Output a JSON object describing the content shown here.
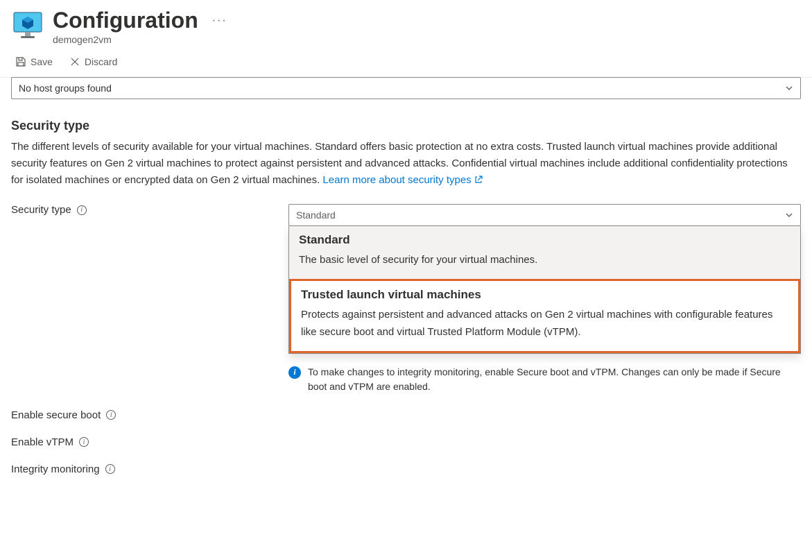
{
  "header": {
    "title": "Configuration",
    "subtitle": "demogen2vm"
  },
  "toolbar": {
    "save_label": "Save",
    "discard_label": "Discard"
  },
  "host_group": {
    "selected": "No host groups found"
  },
  "security": {
    "heading": "Security type",
    "description_pre": "The different levels of security available for your virtual machines. Standard offers basic protection at no extra costs. Trusted launch virtual machines provide additional security features on Gen 2 virtual machines to protect against persistent and advanced attacks. Confidential virtual machines include additional confidentiality protections for isolated machines or encrypted data on Gen 2 virtual machines. ",
    "learn_more": "Learn more about security types",
    "fields": {
      "security_type_label": "Security type",
      "secure_boot_label": "Enable secure boot",
      "vtpm_label": "Enable vTPM",
      "integrity_label": "Integrity monitoring"
    },
    "dropdown_selected": "Standard",
    "options": [
      {
        "title": "Standard",
        "desc": "The basic level of security for your virtual machines."
      },
      {
        "title": "Trusted launch virtual machines",
        "desc": "Protects against persistent and advanced attacks on Gen 2 virtual machines with configurable features like secure boot and virtual Trusted Platform Module (vTPM)."
      }
    ],
    "integrity_info": "To make changes to integrity monitoring, enable Secure boot and vTPM. Changes can only be made if Secure boot and vTPM are enabled."
  }
}
